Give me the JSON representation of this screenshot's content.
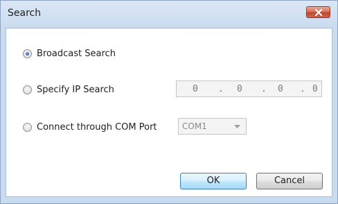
{
  "window": {
    "title": "Search",
    "close_icon": "close-icon"
  },
  "options": {
    "broadcast": {
      "label": "Broadcast Search",
      "selected": true
    },
    "specify_ip": {
      "label": "Specify IP Search",
      "selected": false
    },
    "com_port": {
      "label": "Connect through COM Port",
      "selected": false
    }
  },
  "ip_address": {
    "octet1": "0",
    "octet2": "0",
    "octet3": "0",
    "octet4": "0",
    "dot": "."
  },
  "com_port_select": {
    "value": "COM1"
  },
  "buttons": {
    "ok": "OK",
    "cancel": "Cancel"
  },
  "colors": {
    "title_bar": "#c9dbef",
    "close_button": "#c0452c",
    "radio_selected": "#1f5fb0",
    "default_button_border": "#3c7fb1"
  }
}
